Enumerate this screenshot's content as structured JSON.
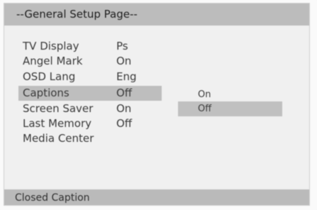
{
  "header": {
    "title": "--General Setup Page--"
  },
  "menu": {
    "items": [
      {
        "label": "TV Display",
        "value": "Ps"
      },
      {
        "label": "Angel Mark",
        "value": "On"
      },
      {
        "label": "OSD Lang",
        "value": "Eng"
      },
      {
        "label": "Captions",
        "value": "Off",
        "selected": true
      },
      {
        "label": "Screen Saver",
        "value": "On"
      },
      {
        "label": "Last Memory",
        "value": "Off"
      },
      {
        "label": "Media Center",
        "value": ""
      }
    ]
  },
  "options": {
    "items": [
      {
        "label": "On"
      },
      {
        "label": "Off",
        "selected": true
      }
    ]
  },
  "statusbar": {
    "text": "Closed Caption"
  },
  "colors": {
    "header_bg": "#bcbcbc",
    "highlight_bg": "#bebebe",
    "panel_bg": "#f0f0f0",
    "status_bg": "#bababa"
  }
}
